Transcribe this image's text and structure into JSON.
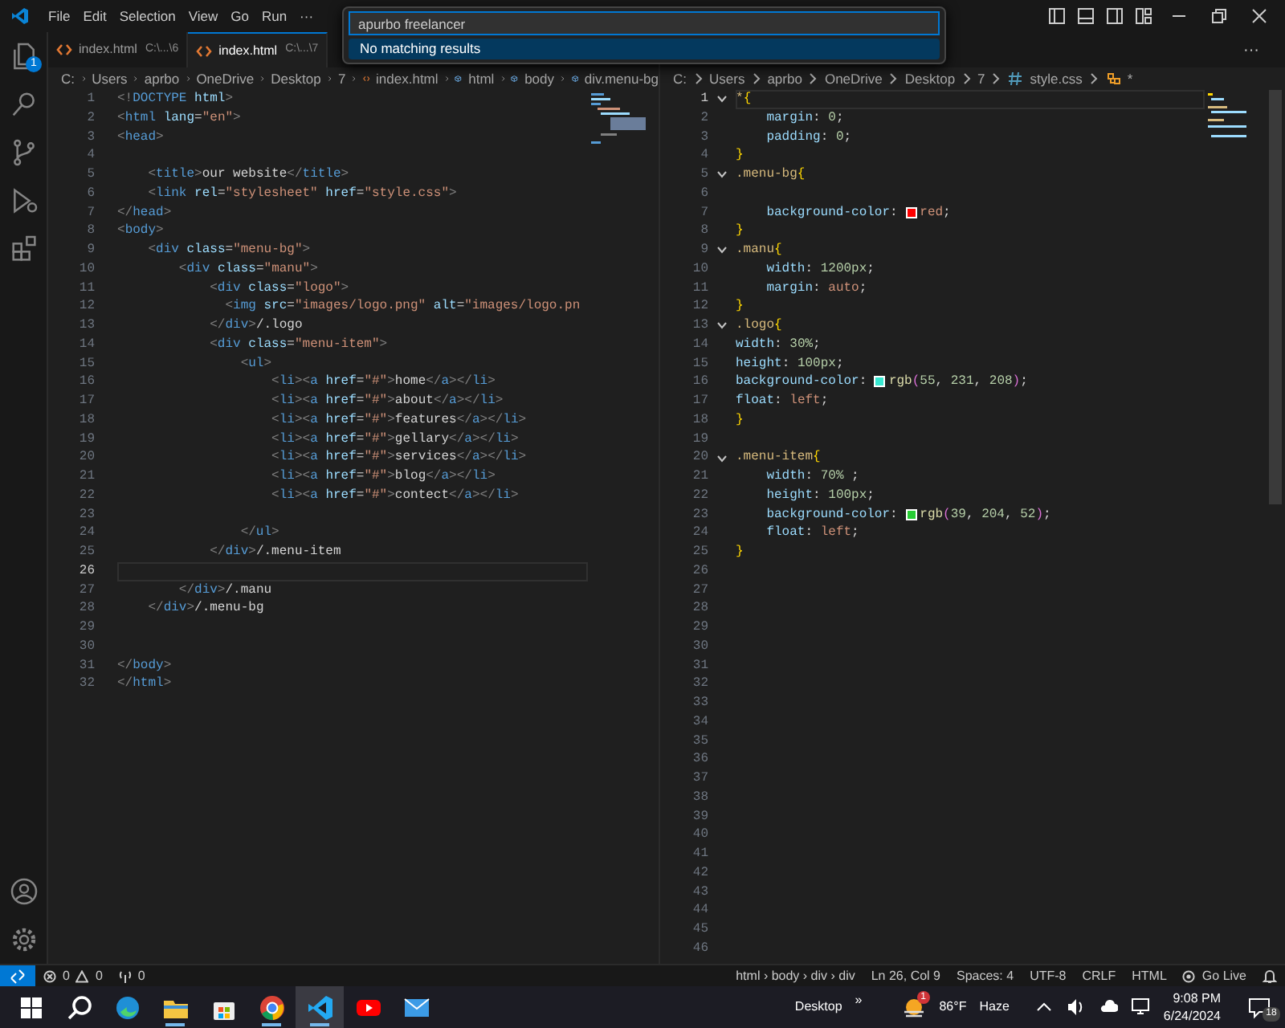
{
  "title_bar": {
    "menu": [
      "File",
      "Edit",
      "Selection",
      "View",
      "Go",
      "Run"
    ],
    "more": "···",
    "controls": [
      {
        "kind": "toggle-sidebar"
      },
      {
        "kind": "toggle-panel"
      },
      {
        "kind": "toggle-secondary"
      },
      {
        "kind": "customize-layout"
      },
      {
        "kind": "minimize"
      },
      {
        "kind": "restore"
      },
      {
        "kind": "close"
      }
    ]
  },
  "command_palette": {
    "value": "apurbo freelancer",
    "message": "No matching results"
  },
  "activity_bar": {
    "top": [
      {
        "kind": "explorer",
        "badge": "1"
      },
      {
        "kind": "search"
      },
      {
        "kind": "source-control"
      },
      {
        "kind": "run-debug"
      },
      {
        "kind": "extensions"
      }
    ],
    "bottom": [
      {
        "kind": "account"
      },
      {
        "kind": "settings"
      }
    ]
  },
  "editor_groups": [
    {
      "kind": "html",
      "tabs": [
        {
          "label": "index.html",
          "path": "C:\\...\\6",
          "selected": false
        },
        {
          "label": "index.html",
          "path": "C:\\...\\7",
          "selected": true
        }
      ],
      "breadcrumbs": [
        {
          "kind": "folder",
          "label": "C:"
        },
        {
          "kind": "folder",
          "label": "Users"
        },
        {
          "kind": "folder",
          "label": "aprbo"
        },
        {
          "kind": "folder",
          "label": "OneDrive"
        },
        {
          "kind": "folder",
          "label": "Desktop"
        },
        {
          "kind": "folder",
          "label": "7"
        },
        {
          "kind": "html-file",
          "label": "index.html"
        },
        {
          "kind": "element",
          "label": "html"
        },
        {
          "kind": "element",
          "label": "body"
        },
        {
          "kind": "element",
          "label": "div.menu-bg"
        }
      ],
      "lines": [
        {
          "number": "1",
          "code": "<!DOCTYPE html>",
          "current": false
        },
        {
          "number": "2",
          "code": "<html lang=\"en\">",
          "current": false
        },
        {
          "number": "3",
          "code": "<head>",
          "current": false
        },
        {
          "number": "4",
          "current": false
        },
        {
          "number": "5",
          "code": "    <title>our website</title>",
          "current": false
        },
        {
          "number": "6",
          "code": "    <link rel=\"stylesheet\" href=\"style.css\">",
          "current": false
        },
        {
          "number": "7",
          "code": "</head>",
          "current": false
        },
        {
          "number": "8",
          "code": "<body>",
          "current": false
        },
        {
          "number": "9",
          "code": "    <div class=\"menu-bg\">",
          "current": false
        },
        {
          "number": "10",
          "code": "        <div class=\"manu\">",
          "current": false
        },
        {
          "number": "11",
          "code": "            <div class=\"logo\">",
          "current": false
        },
        {
          "number": "12",
          "code": "              <img src=\"images/logo.png\" alt=\"images/logo.pn",
          "current": false
        },
        {
          "number": "13",
          "code": "            </div>/.logo",
          "current": false
        },
        {
          "number": "14",
          "code": "            <div class=\"menu-item\">",
          "current": false
        },
        {
          "number": "15",
          "code": "                <ul>",
          "current": false
        },
        {
          "number": "16",
          "code": "                    <li><a href=\"#\">home</a></li>",
          "current": false
        },
        {
          "number": "17",
          "code": "                    <li><a href=\"#\">about</a></li>",
          "current": false
        },
        {
          "number": "18",
          "code": "                    <li><a href=\"#\">features</a></li>",
          "current": false
        },
        {
          "number": "19",
          "code": "                    <li><a href=\"#\">gellary</a></li>",
          "current": false
        },
        {
          "number": "20",
          "code": "                    <li><a href=\"#\">services</a></li>",
          "current": false
        },
        {
          "number": "21",
          "code": "                    <li><a href=\"#\">blog</a></li>",
          "current": false
        },
        {
          "number": "22",
          "code": "                    <li><a href=\"#\">contect</a></li>",
          "current": false
        },
        {
          "number": "23",
          "current": false
        },
        {
          "number": "24",
          "code": "                </ul>",
          "current": false
        },
        {
          "number": "25",
          "code": "            </div>/.menu-item",
          "current": false
        },
        {
          "number": "26",
          "current": true
        },
        {
          "number": "27",
          "code": "        </div>/.manu",
          "current": false
        },
        {
          "number": "28",
          "code": "    </div>/.menu-bg",
          "current": false
        },
        {
          "number": "29",
          "current": false
        },
        {
          "number": "30",
          "current": false
        },
        {
          "number": "31",
          "code": "</body>",
          "current": false
        },
        {
          "number": "32",
          "code": "</html>",
          "current": false
        }
      ]
    },
    {
      "kind": "css",
      "more": "···",
      "breadcrumbs": [
        {
          "kind": "folder",
          "label": "C:"
        },
        {
          "kind": "folder",
          "label": "Users"
        },
        {
          "kind": "folder",
          "label": "aprbo"
        },
        {
          "kind": "folder",
          "label": "OneDrive"
        },
        {
          "kind": "folder",
          "label": "Desktop"
        },
        {
          "kind": "folder",
          "label": "7"
        },
        {
          "kind": "css-file",
          "label": "style.css"
        },
        {
          "kind": "selector",
          "label": "*"
        }
      ],
      "lines": [
        {
          "number": "1",
          "code": "*{",
          "current": true,
          "foldable": true
        },
        {
          "number": "2",
          "code": "    margin: 0;",
          "current": false,
          "foldable": false
        },
        {
          "number": "3",
          "code": "    padding: 0;",
          "current": false,
          "foldable": false
        },
        {
          "number": "4",
          "code": "}",
          "current": false,
          "foldable": false
        },
        {
          "number": "5",
          "code": ".menu-bg{",
          "current": false,
          "foldable": true
        },
        {
          "number": "6",
          "current": false,
          "foldable": false
        },
        {
          "number": "7",
          "code": "    background-color: ",
          "color": "#ff0000",
          "value": "red;",
          "current": false,
          "foldable": false
        },
        {
          "number": "8",
          "code": "}",
          "current": false,
          "foldable": false
        },
        {
          "number": "9",
          "code": ".manu{",
          "current": false,
          "foldable": true
        },
        {
          "number": "10",
          "code": "    width: 1200px;",
          "current": false,
          "foldable": false
        },
        {
          "number": "11",
          "code": "    margin: auto;",
          "current": false,
          "foldable": false
        },
        {
          "number": "12",
          "code": "}",
          "current": false,
          "foldable": false
        },
        {
          "number": "13",
          "code": ".logo{",
          "current": false,
          "foldable": true
        },
        {
          "number": "14",
          "code": "width: 30%;",
          "current": false,
          "foldable": false
        },
        {
          "number": "15",
          "code": "height: 100px;",
          "current": false,
          "foldable": false
        },
        {
          "number": "16",
          "code": "background-color: ",
          "color": "#37e7d0",
          "value": "rgb(55, 231, 208);",
          "current": false,
          "foldable": false
        },
        {
          "number": "17",
          "code": "float: left;",
          "current": false,
          "foldable": false
        },
        {
          "number": "18",
          "code": "}",
          "current": false,
          "foldable": false
        },
        {
          "number": "19",
          "current": false,
          "foldable": false
        },
        {
          "number": "20",
          "code": ".menu-item{",
          "current": false,
          "foldable": true
        },
        {
          "number": "21",
          "code": "    width: 70% ;",
          "current": false,
          "foldable": false
        },
        {
          "number": "22",
          "code": "    height: 100px;",
          "current": false,
          "foldable": false
        },
        {
          "number": "23",
          "code": "    background-color: ",
          "color": "#27cc34",
          "value": "rgb(39, 204, 52);",
          "current": false,
          "foldable": false
        },
        {
          "number": "24",
          "code": "    float: left;",
          "current": false,
          "foldable": false
        },
        {
          "number": "25",
          "code": "}",
          "current": false,
          "foldable": false
        },
        {
          "number": "26",
          "current": false,
          "foldable": false
        },
        {
          "number": "27",
          "current": false,
          "foldable": false
        },
        {
          "number": "28",
          "current": false,
          "foldable": false
        },
        {
          "number": "29",
          "current": false,
          "foldable": false
        },
        {
          "number": "30",
          "current": false,
          "foldable": false
        },
        {
          "number": "31",
          "current": false,
          "foldable": false
        },
        {
          "number": "32",
          "current": false,
          "foldable": false
        },
        {
          "number": "33",
          "current": false,
          "foldable": false
        },
        {
          "number": "34",
          "current": false,
          "foldable": false
        },
        {
          "number": "35",
          "current": false,
          "foldable": false
        },
        {
          "number": "36",
          "current": false,
          "foldable": false
        },
        {
          "number": "37",
          "current": false,
          "foldable": false
        },
        {
          "number": "38",
          "current": false,
          "foldable": false
        },
        {
          "number": "39",
          "current": false,
          "foldable": false
        },
        {
          "number": "40",
          "current": false,
          "foldable": false
        },
        {
          "number": "41",
          "current": false,
          "foldable": false
        },
        {
          "number": "42",
          "current": false,
          "foldable": false
        },
        {
          "number": "43",
          "current": false,
          "foldable": false
        },
        {
          "number": "44",
          "current": false,
          "foldable": false
        },
        {
          "number": "45",
          "current": false,
          "foldable": false
        },
        {
          "number": "46",
          "current": false,
          "foldable": false
        }
      ]
    }
  ],
  "status_bar": {
    "left": [
      {
        "kind": "remote"
      },
      {
        "kind": "problems",
        "errors": "0",
        "warnings": "0"
      },
      {
        "kind": "ports",
        "count": "0"
      }
    ],
    "right": [
      {
        "kind": "text",
        "label": "html › body › div › div"
      },
      {
        "kind": "text",
        "label": "Ln 26, Col 9"
      },
      {
        "kind": "text",
        "label": "Spaces: 4"
      },
      {
        "kind": "text",
        "label": "UTF-8"
      },
      {
        "kind": "text",
        "label": "CRLF"
      },
      {
        "kind": "text",
        "label": "HTML"
      },
      {
        "kind": "go-live",
        "label": "Go Live"
      },
      {
        "kind": "bell"
      }
    ]
  },
  "taskbar": {
    "apps": [
      {
        "kind": "start",
        "running": false,
        "selected": false
      },
      {
        "kind": "search",
        "running": false,
        "selected": false
      },
      {
        "kind": "edge",
        "running": false,
        "selected": false
      },
      {
        "kind": "file-explorer",
        "running": true,
        "selected": false
      },
      {
        "kind": "store",
        "running": false,
        "selected": false
      },
      {
        "kind": "chrome",
        "running": true,
        "selected": false
      },
      {
        "kind": "vscode",
        "running": true,
        "selected": true
      },
      {
        "kind": "youtube",
        "running": false,
        "selected": false
      },
      {
        "kind": "mail",
        "running": false,
        "selected": false
      }
    ],
    "desktop": {
      "label": "Desktop",
      "overflow": "»"
    },
    "weather": {
      "badge": "1",
      "temperature": "86°F",
      "condition": "Haze"
    },
    "tray": [
      {
        "kind": "chevron"
      },
      {
        "kind": "volume"
      },
      {
        "kind": "cloud"
      },
      {
        "kind": "network"
      }
    ],
    "clock": {
      "time": "9:08 PM",
      "date": "6/24/2024"
    },
    "notifications": {
      "count": "18"
    }
  }
}
